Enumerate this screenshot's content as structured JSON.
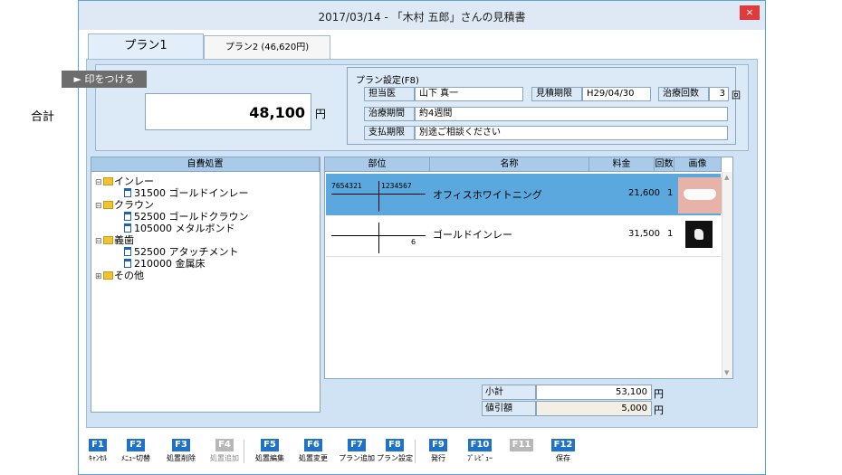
{
  "window": {
    "title": "2017/03/14 - 「木村 五郎」さんの見積書",
    "close": "×"
  },
  "tabs": [
    {
      "label": "プラン1"
    },
    {
      "label": "プラン2 (46,620円)"
    }
  ],
  "summary": {
    "stamp_button": "► 印をつける",
    "total_label": "合計",
    "total_value": "48,100",
    "total_unit": "円"
  },
  "plan": {
    "legend": "プラン設定(F8)",
    "doctor_label": "担当医",
    "doctor_value": "山下 真一",
    "validity_label": "見積期限",
    "validity_value": "H29/04/30",
    "visits_label": "治療回数",
    "visits_value": "3",
    "visits_unit": "回",
    "period_label": "治療期間",
    "period_value": "約4週間",
    "payment_label": "支払期限",
    "payment_value": "別途ご相談ください"
  },
  "tree": {
    "header": "自費処置",
    "items": [
      {
        "label": "インレー"
      },
      {
        "label": "31500 ゴールドインレー"
      },
      {
        "label": "クラウン"
      },
      {
        "label": "52500 ゴールドクラウン"
      },
      {
        "label": "105000 メタルボンド"
      },
      {
        "label": "義歯"
      },
      {
        "label": "52500 アタッチメント"
      },
      {
        "label": "210000 金属床"
      },
      {
        "label": "その他"
      }
    ]
  },
  "grid": {
    "columns": [
      "部位",
      "名称",
      "料金",
      "回数",
      "画像"
    ],
    "rows": [
      {
        "tooth_upper_right": "7654321",
        "tooth_upper_left": "1234567",
        "tooth_lower_right": "",
        "tooth_lower_left": "",
        "name": "オフィスホワイトニング",
        "price": "21,600",
        "count": "1",
        "image": "teeth-photo"
      },
      {
        "tooth_upper_right": "",
        "tooth_upper_left": "",
        "tooth_lower_right": "",
        "tooth_lower_left": "6",
        "name": "ゴールドインレー",
        "price": "31,500",
        "count": "1",
        "image": "inlay-photo"
      }
    ]
  },
  "totals": {
    "subtotal_label": "小計",
    "subtotal_value": "53,100",
    "subtotal_unit": "円",
    "discount_label": "値引額",
    "discount_value": "5,000",
    "discount_unit": "円"
  },
  "fkeys": [
    {
      "key": "F1",
      "label": "ｷｬﾝｾﾙ",
      "enabled": true
    },
    {
      "key": "F2",
      "label": "ﾒﾆｭｰ切替",
      "enabled": true
    },
    {
      "key": "F3",
      "label": "処置削除",
      "enabled": true
    },
    {
      "key": "F4",
      "label": "処置追加",
      "enabled": false
    },
    {
      "key": "F5",
      "label": "処置編集",
      "enabled": true
    },
    {
      "key": "F6",
      "label": "処置変更",
      "enabled": true
    },
    {
      "key": "F7",
      "label": "プラン追加",
      "enabled": true
    },
    {
      "key": "F8",
      "label": "プラン設定",
      "enabled": true
    },
    {
      "key": "F9",
      "label": "発行",
      "enabled": true
    },
    {
      "key": "F10",
      "label": "ﾌﾟﾚﾋﾞｭｰ",
      "enabled": true
    },
    {
      "key": "F11",
      "label": "",
      "enabled": false
    },
    {
      "key": "F12",
      "label": "保存",
      "enabled": true
    }
  ],
  "colors": {
    "accent": "#1e73c9",
    "selected_row": "#5aa8dd",
    "panel": "#cfe3f5",
    "header": "#a9cbe9",
    "close": "#e23a3a"
  }
}
